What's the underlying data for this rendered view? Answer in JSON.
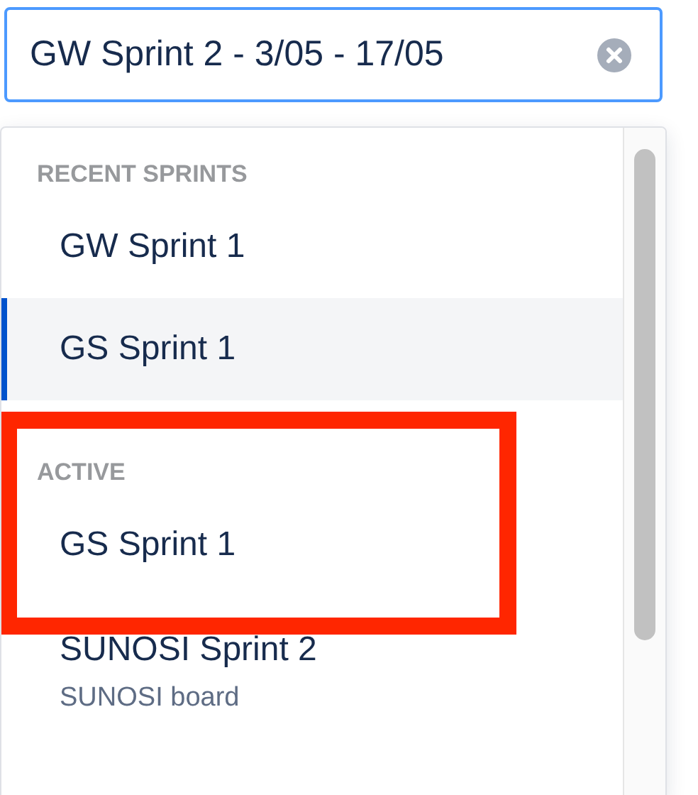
{
  "search": {
    "value": "GW Sprint 2 - 3/05 - 17/05"
  },
  "sections": [
    {
      "heading": "RECENT SPRINTS",
      "highlighted": false,
      "items": [
        {
          "name": "GW Sprint 1",
          "selected": false
        },
        {
          "name": "GS Sprint 1",
          "selected": true
        }
      ]
    },
    {
      "heading": "ACTIVE",
      "highlighted": true,
      "items": [
        {
          "name": "GS Sprint 1",
          "selected": false
        },
        {
          "name": "SUNOSI Sprint 2",
          "subtitle": "SUNOSI board",
          "selected": false
        }
      ]
    }
  ]
}
